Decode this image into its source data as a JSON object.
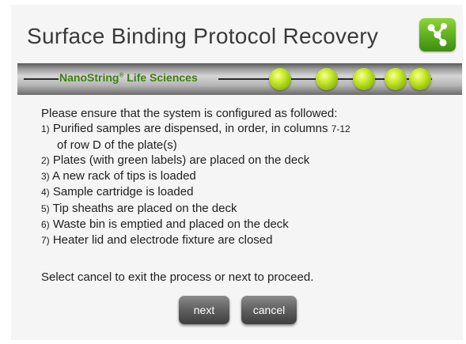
{
  "header": {
    "title": "Surface Binding Protocol Recovery",
    "icon": "network-nodes-icon"
  },
  "brand": {
    "name": "NanoString",
    "mark": "®",
    "suffix": " Life Sciences",
    "progress_dots": 5,
    "accent_color": "#8fb80c"
  },
  "instructions": {
    "intro": "Please ensure that the system is configured as followed:",
    "items": [
      {
        "num": "1)",
        "text": " Purified samples are dispensed, in order, in columns ",
        "extra": "7-12",
        "cont": "of row D of the plate(s)"
      },
      {
        "num": "2)",
        "text": " Plates (with green labels) are placed on the deck"
      },
      {
        "num": "3)",
        "text": " A new rack of tips is loaded"
      },
      {
        "num": "4)",
        "text": " Sample cartridge is loaded"
      },
      {
        "num": "5)",
        "text": " Tip sheaths are placed on the deck"
      },
      {
        "num": "6)",
        "text": " Waste bin is emptied and placed on the deck"
      },
      {
        "num": "7)",
        "text": " Heater lid and electrode fixture are closed"
      }
    ]
  },
  "footer": {
    "prompt": "Select cancel to exit the process or next to proceed.",
    "next_label": "next",
    "cancel_label": "cancel"
  }
}
